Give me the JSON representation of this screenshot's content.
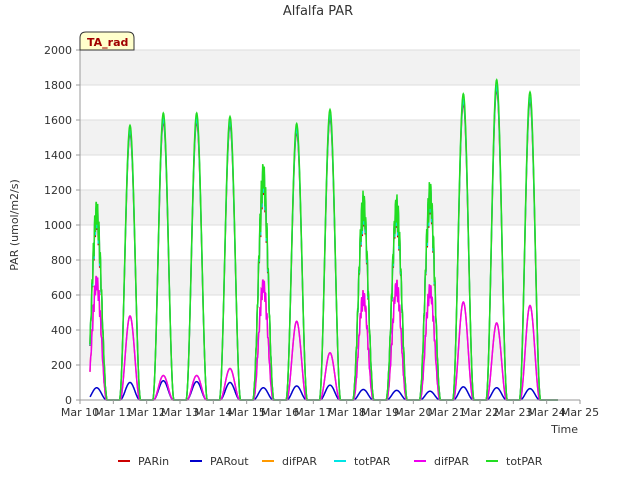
{
  "chart_data": {
    "type": "line",
    "title": "Alfalfa PAR",
    "xlabel": "Time",
    "ylabel": "PAR (umol/m2/s)",
    "ylim": [
      0,
      2000
    ],
    "yticks": [
      0,
      200,
      400,
      600,
      800,
      1000,
      1200,
      1400,
      1600,
      1800,
      2000
    ],
    "xlim": [
      10,
      25
    ],
    "xticks": [
      {
        "v": 10,
        "label": "Mar 10"
      },
      {
        "v": 11,
        "label": "Mar 11"
      },
      {
        "v": 12,
        "label": "Mar 12"
      },
      {
        "v": 13,
        "label": "Mar 13"
      },
      {
        "v": 14,
        "label": "Mar 14"
      },
      {
        "v": 15,
        "label": "Mar 15"
      },
      {
        "v": 16,
        "label": "Mar 16"
      },
      {
        "v": 17,
        "label": "Mar 17"
      },
      {
        "v": 18,
        "label": "Mar 18"
      },
      {
        "v": 19,
        "label": "Mar 19"
      },
      {
        "v": 20,
        "label": "Mar 20"
      },
      {
        "v": 21,
        "label": "Mar 21"
      },
      {
        "v": 22,
        "label": "Mar 22"
      },
      {
        "v": 23,
        "label": "Mar 23"
      },
      {
        "v": 24,
        "label": "Mar 24"
      },
      {
        "v": 25,
        "label": "Mar 25"
      }
    ],
    "grid": true,
    "legend_position": "bottom",
    "annotation": "TA_rad",
    "days": [
      {
        "day": 10.5,
        "peak": 1150,
        "dif": 720,
        "out": 70
      },
      {
        "day": 11.5,
        "peak": 1570,
        "dif": 480,
        "out": 100
      },
      {
        "day": 12.5,
        "peak": 1640,
        "dif": 140,
        "out": 110
      },
      {
        "day": 13.5,
        "peak": 1640,
        "dif": 140,
        "out": 105
      },
      {
        "day": 14.5,
        "peak": 1620,
        "dif": 180,
        "out": 100
      },
      {
        "day": 15.5,
        "peak": 1370,
        "dif": 700,
        "out": 70
      },
      {
        "day": 16.5,
        "peak": 1580,
        "dif": 450,
        "out": 80
      },
      {
        "day": 17.5,
        "peak": 1660,
        "dif": 270,
        "out": 85
      },
      {
        "day": 18.5,
        "peak": 1200,
        "dif": 630,
        "out": 60
      },
      {
        "day": 19.5,
        "peak": 1180,
        "dif": 690,
        "out": 55
      },
      {
        "day": 20.5,
        "peak": 1260,
        "dif": 670,
        "out": 50
      },
      {
        "day": 21.5,
        "peak": 1750,
        "dif": 560,
        "out": 75
      },
      {
        "day": 22.5,
        "peak": 1830,
        "dif": 440,
        "out": 70
      },
      {
        "day": 23.5,
        "peak": 1760,
        "dif": 540,
        "out": 65
      }
    ],
    "series": [
      {
        "name": "PARin",
        "color": "#cc0000"
      },
      {
        "name": "PARout",
        "color": "#0000cc"
      },
      {
        "name": "difPAR",
        "color": "#ff9900"
      },
      {
        "name": "totPAR",
        "color": "#00e5e5"
      },
      {
        "name": "difPAR",
        "color": "#ee00ee"
      },
      {
        "name": "totPAR",
        "color": "#22dd22"
      }
    ]
  }
}
